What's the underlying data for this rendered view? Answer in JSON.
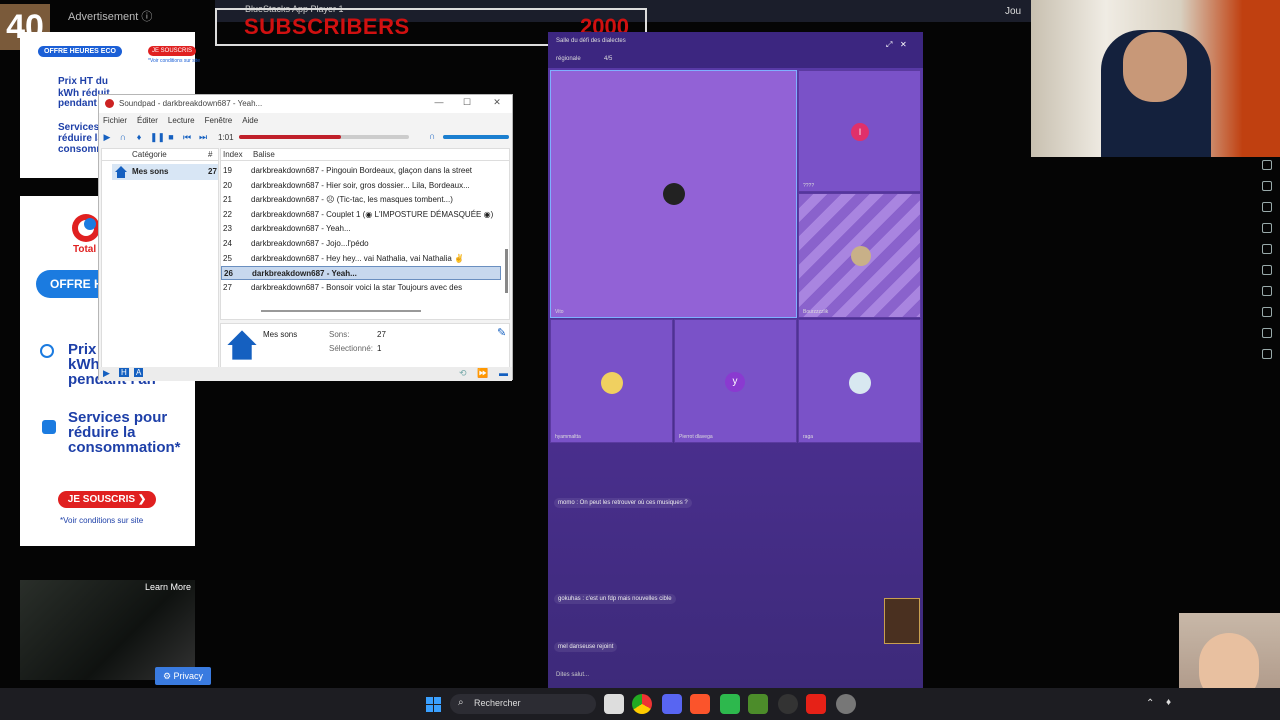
{
  "overlay": {
    "counter": "40",
    "ad_label": "Advertisement ⓘ",
    "subscribers_label": "SUBSCRIBERS",
    "subscribers_count": "2000",
    "bluestacks_title": "BlueStacks App Player 1",
    "top_right_text": "Jou"
  },
  "ads": {
    "ad1_tag": "OFFRE HEURES ECO",
    "ad1_button": "JE SOUSCRIS",
    "ad1_conditions": "*Voir conditions sur site",
    "ad1_line1": "Prix HT du",
    "ad1_line2": "kWh réduit",
    "ad1_line3": "pendant",
    "ad1_line4": "Services",
    "ad1_line5": "réduire la",
    "ad1_line6": "consomma",
    "total_text": "Total",
    "offer_button": "OFFRE H",
    "prix_l1": "Prix",
    "prix_l2": "kWh",
    "prix_l3": "pendant l'an",
    "services_l1": "Services pour",
    "services_l2": "réduire la",
    "services_l3": "consommation*",
    "souscris": "JE SOUSCRIS  ❯",
    "voir": "*Voir conditions sur site",
    "learn_more": "Learn More",
    "privacy": "⚙ Privacy"
  },
  "soundpad": {
    "title": "Soundpad - darkbreakdown687 - Yeah...",
    "menu": [
      "Fichier",
      "Éditer",
      "Lecture",
      "Fenêtre",
      "Aide"
    ],
    "time": "1:01",
    "progress_fraction": 0.6,
    "volume_fraction": 1.0,
    "category_header": "Catégorie",
    "count_header": "#",
    "category": {
      "name": "Mes sons",
      "count": "27"
    },
    "index_header": "Index",
    "tag_header": "Balise",
    "rows": [
      {
        "index": "19",
        "name": "darkbreakdown687 - Pingouin Bordeaux, glaçon dans la street"
      },
      {
        "index": "20",
        "name": "darkbreakdown687 - Hier soir, gros dossier... Lila, Bordeaux..."
      },
      {
        "index": "21",
        "name": "darkbreakdown687 - ☹ (Tic-tac, les masques tombent...)"
      },
      {
        "index": "22",
        "name": "darkbreakdown687 - Couplet 1 (◉ L'IMPOSTURE DÉMASQUÉE ◉)"
      },
      {
        "index": "23",
        "name": "darkbreakdown687 - Yeah..."
      },
      {
        "index": "24",
        "name": "darkbreakdown687 - Jojo...l'pédo"
      },
      {
        "index": "25",
        "name": "darkbreakdown687 - Hey hey... vai Nathalia, vai Nathalia ✌"
      },
      {
        "index": "26",
        "name": "darkbreakdown687 - Yeah...",
        "selected": true
      },
      {
        "index": "27",
        "name": "darkbreakdown687 - Bonsoir voici la star Toujours avec des"
      }
    ],
    "info_title": "Mes sons",
    "info_sons_label": "Sons:",
    "info_sons_value": "27",
    "info_sel_label": "Sélectionné:",
    "info_sel_value": "1"
  },
  "game": {
    "header": "Salle du défi des dialectes",
    "tab1": "régionale",
    "tab2": "4/5",
    "tiles": [
      {
        "name": "Vito",
        "initial": ""
      },
      {
        "name": "????",
        "initial": "l"
      },
      {
        "name": "Bourzzzzlik",
        "initial": ""
      },
      {
        "name": "hyammaltta",
        "initial": ""
      },
      {
        "name": "Pierrot dlavega",
        "initial": "y"
      },
      {
        "name": "raga",
        "initial": ""
      }
    ],
    "chat": [
      "momo : On peut les retrouver où ces musiques ?",
      "gokuhas : c'est un fdp mais nouvelles cible",
      "mel danseuse rejoint"
    ],
    "input_placeholder": "Dites salut..."
  },
  "taskbar": {
    "search_placeholder": "Rechercher"
  },
  "colors": {
    "accent_red": "#d01010",
    "soundpad_blue": "#1560c0",
    "game_purple": "#5a3aa8"
  }
}
